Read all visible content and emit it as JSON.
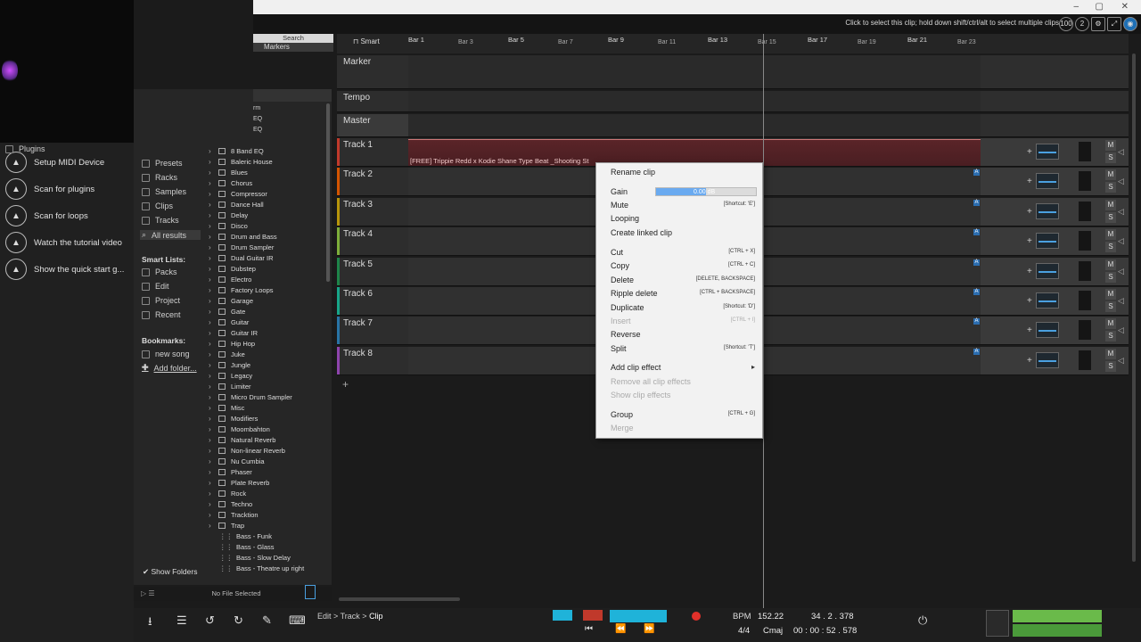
{
  "header": {
    "hint": "Click to select this clip; hold down shift/ctrl/alt to select multiple clips",
    "zoom_label": "100",
    "count_label": "2"
  },
  "browser": {
    "search_label": "Search",
    "markers_tab": "Markers",
    "top_items": [
      "rm",
      "EQ",
      "EQ"
    ],
    "categories": [
      "Plugins",
      "Presets",
      "Racks",
      "Samples",
      "Clips",
      "Tracks",
      "All results"
    ],
    "smart_lists_heading": "Smart Lists:",
    "smart_lists": [
      "Packs",
      "Edit",
      "Project",
      "Recent"
    ],
    "bookmarks_heading": "Bookmarks:",
    "bookmarks": [
      "new song",
      "Add folder..."
    ],
    "folders": [
      "8 Band EQ",
      "Baleric House",
      "Blues",
      "Chorus",
      "Compressor",
      "Dance Hall",
      "Delay",
      "Disco",
      "Drum and Bass",
      "Drum Sampler",
      "Dual Guitar IR",
      "Dubstep",
      "Electro",
      "Factory Loops",
      "Garage",
      "Gate",
      "Guitar",
      "Guitar IR",
      "Hip Hop",
      "Juke",
      "Jungle",
      "Legacy",
      "Limiter",
      "Micro Drum Sampler",
      "Misc",
      "Modifiers",
      "Moombahton",
      "Natural Reverb",
      "Non-linear Reverb",
      "Nu Cumbia",
      "Phaser",
      "Plate Reverb",
      "Rock",
      "Techno",
      "Tracktion",
      "Trap"
    ],
    "presets": [
      "Bass - Funk",
      "Bass - Glass",
      "Bass - Slow Delay",
      "Bass - Theatre up right"
    ],
    "show_folders": "Show Folders",
    "no_file": "No File Selected"
  },
  "quick_actions": [
    "Setup MIDI Device",
    "Scan for plugins",
    "Scan for loops",
    "Watch the tutorial video",
    "Show the quick start g..."
  ],
  "ruler": {
    "snap_label": "Smart",
    "major": [
      "Bar 1",
      "Bar 5",
      "Bar 9",
      "Bar 13",
      "Bar 17",
      "Bar 21"
    ],
    "minor": [
      "Bar 3",
      "Bar 7",
      "Bar 11",
      "Bar 15",
      "Bar 19",
      "Bar 23"
    ]
  },
  "tracks": {
    "special": [
      "Marker",
      "Tempo",
      "Master"
    ],
    "list": [
      {
        "name": "Track 1",
        "color": "#c0392b"
      },
      {
        "name": "Track 2",
        "color": "#d35400"
      },
      {
        "name": "Track 3",
        "color": "#b7950b"
      },
      {
        "name": "Track 4",
        "color": "#7dae3a"
      },
      {
        "name": "Track 5",
        "color": "#1e8449"
      },
      {
        "name": "Track 6",
        "color": "#17a589"
      },
      {
        "name": "Track 7",
        "color": "#2874a6"
      },
      {
        "name": "Track 8",
        "color": "#8e44ad"
      }
    ],
    "clip_label": "[FREE] Trippie Redd x Kodie Shane Type Beat _Shooting St",
    "mute_label": "M",
    "solo_label": "S"
  },
  "context_menu": {
    "rename": "Rename clip",
    "gain_label": "Gain",
    "gain_value": "0.00 dB",
    "gain_fraction": 0.5,
    "items": [
      {
        "label": "Mute",
        "shortcut": "[Shortcut: 'E']",
        "enabled": true
      },
      {
        "label": "Looping",
        "shortcut": "",
        "enabled": true
      },
      {
        "label": "Create linked clip",
        "shortcut": "",
        "enabled": true
      },
      {
        "label": "Cut",
        "shortcut": "[CTRL + X]",
        "enabled": true
      },
      {
        "label": "Copy",
        "shortcut": "[CTRL + C]",
        "enabled": true
      },
      {
        "label": "Delete",
        "shortcut": "[DELETE, BACKSPACE]",
        "enabled": true
      },
      {
        "label": "Ripple delete",
        "shortcut": "[CTRL + BACKSPACE]",
        "enabled": true
      },
      {
        "label": "Duplicate",
        "shortcut": "[Shortcut: 'D']",
        "enabled": true
      },
      {
        "label": "Insert",
        "shortcut": "[CTRL + I]",
        "enabled": false
      },
      {
        "label": "Reverse",
        "shortcut": "",
        "enabled": true
      },
      {
        "label": "Split",
        "shortcut": "[Shortcut: 'T']",
        "enabled": true
      },
      {
        "label": "Add clip effect",
        "shortcut": "",
        "enabled": true
      },
      {
        "label": "Remove all clip effects",
        "shortcut": "",
        "enabled": false
      },
      {
        "label": "Show clip effects",
        "shortcut": "",
        "enabled": false
      },
      {
        "label": "Group",
        "shortcut": "[CTRL + G]",
        "enabled": true
      },
      {
        "label": "Merge",
        "shortcut": "",
        "enabled": false
      }
    ]
  },
  "breadcrumb": {
    "edit": "Edit",
    "track": "Track",
    "clip": "Clip"
  },
  "transport": {
    "bpm_label": "BPM",
    "bpm": "152.22",
    "position": "34 . 2 . 378",
    "time_signature": "4/4",
    "key": "Cmaj",
    "time": "00 : 00 : 52 . 578"
  },
  "colors": {
    "accent": "#4aa0e0",
    "record": "#e0302a",
    "transport_active": "#1fb3d9"
  }
}
